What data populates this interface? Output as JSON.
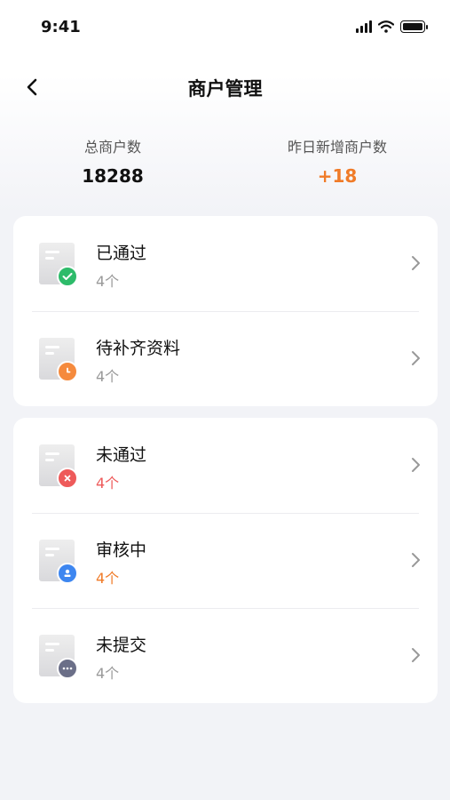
{
  "status_bar": {
    "time": "9:41"
  },
  "nav": {
    "title": "商户管理"
  },
  "stats": {
    "total_label": "总商户数",
    "total_value": "18288",
    "new_label": "昨日新增商户数",
    "new_value": "+18"
  },
  "colors": {
    "accent_orange": "#f07b28",
    "approved_green": "#2dbb6a",
    "pending_orange": "#f58a3d",
    "rejected_red": "#ee5a5a",
    "reviewing_blue": "#3d86f0",
    "unsubmitted_gray": "#6b6f88"
  },
  "group1": [
    {
      "title": "已通过",
      "count": "4个",
      "icon": "check-icon"
    },
    {
      "title": "待补齐资料",
      "count": "4个",
      "icon": "clock-icon"
    }
  ],
  "group2": [
    {
      "title": "未通过",
      "count": "4个",
      "icon": "x-icon"
    },
    {
      "title": "审核中",
      "count": "4个",
      "icon": "person-icon"
    },
    {
      "title": "未提交",
      "count": "4个",
      "icon": "ellipsis-icon"
    }
  ]
}
